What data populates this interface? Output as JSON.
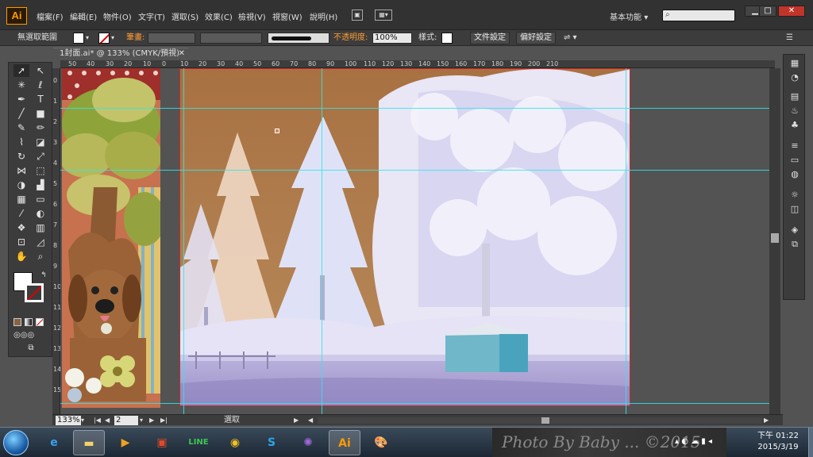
{
  "app": {
    "logo": "Ai"
  },
  "menu": [
    "檔案(F)",
    "編輯(E)",
    "物件(O)",
    "文字(T)",
    "選取(S)",
    "效果(C)",
    "檢視(V)",
    "視窗(W)",
    "說明(H)"
  ],
  "workspace": {
    "label": "基本功能",
    "caret": "▾"
  },
  "window_controls": {
    "minimize": "▁",
    "restore": "□",
    "close": "✕"
  },
  "control_bar": {
    "selection_label": "無選取範圍",
    "stroke_label": "筆畫:",
    "opacity_label": "不透明度:",
    "opacity_value": "100%",
    "style_label": "樣式:",
    "doc_settings": "文件設定",
    "preferences": "偏好設定"
  },
  "document": {
    "tab_title": "1封面.ai* @ 133% (CMYK/預視)",
    "close": "✕"
  },
  "ruler_h": [
    "50",
    "40",
    "30",
    "20",
    "10",
    "0",
    "10",
    "20",
    "30",
    "40",
    "50",
    "60",
    "70",
    "80",
    "90",
    "100",
    "110",
    "120",
    "130",
    "140",
    "150",
    "160",
    "170",
    "180",
    "190",
    "200",
    "210"
  ],
  "ruler_v": [
    "0",
    "1",
    "2",
    "3",
    "4",
    "5",
    "6",
    "7",
    "8",
    "9",
    "10",
    "11",
    "12",
    "13",
    "14",
    "15"
  ],
  "status": {
    "zoom": "133%",
    "page": "2",
    "tool_name": "選取",
    "first": "|◀",
    "prev": "◀",
    "next": "▶",
    "last": "▶|"
  },
  "taskbar": {
    "apps": [
      {
        "name": "explorer",
        "icon": "folder-icon"
      },
      {
        "name": "media",
        "icon": "media-icon"
      },
      {
        "name": "ie",
        "icon": "ie-icon"
      },
      {
        "name": "paint",
        "icon": "paint-icon"
      },
      {
        "name": "line",
        "icon": "line-icon"
      },
      {
        "name": "chrome",
        "icon": "chrome-icon"
      },
      {
        "name": "skype",
        "icon": "skype-icon"
      },
      {
        "name": "picasa",
        "icon": "picasa-icon"
      },
      {
        "name": "illustrator",
        "icon": "ai-icon"
      },
      {
        "name": "paint-palette",
        "icon": "palette-icon"
      }
    ],
    "tray_watermark": "Photo By Baby ... ©2015",
    "time": "下午 01:22",
    "date": "2015/3/19"
  },
  "colors": {
    "accent": "#ff9c33",
    "guide": "#2ee6ef",
    "artboard_border": "#c8282a"
  }
}
